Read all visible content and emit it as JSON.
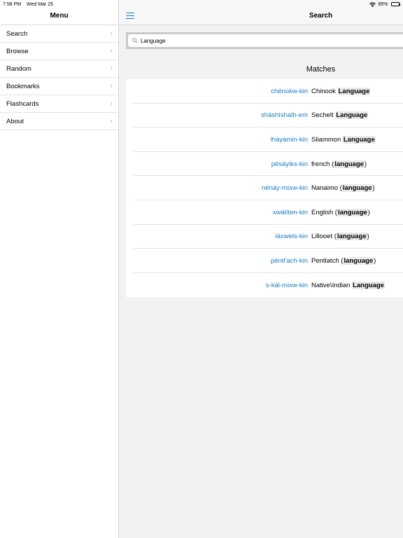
{
  "status_bar": {
    "time": "7:58 PM",
    "date": "Wed Mar 25",
    "battery": "85%",
    "battery_level": 0.85
  },
  "sidebar": {
    "title": "Menu",
    "items": [
      {
        "label": "Search"
      },
      {
        "label": "Browse"
      },
      {
        "label": "Random"
      },
      {
        "label": "Bookmarks"
      },
      {
        "label": "Flashcards"
      },
      {
        "label": "About"
      }
    ]
  },
  "nav": {
    "title": "Search"
  },
  "search": {
    "value": "Language",
    "placeholder": ""
  },
  "matches": {
    "title": "Matches",
    "results": [
      {
        "native": "chénúkw-kin",
        "english_pre": "Chinook ",
        "english_hl": "Language",
        "english_post": ""
      },
      {
        "native": "sháshíshalh-em",
        "english_pre": "Sechelt ",
        "english_hl": "Language",
        "english_post": ""
      },
      {
        "native": "lhàyámin-kin",
        "english_pre": "Sliammon ",
        "english_hl": "Language",
        "english_post": ""
      },
      {
        "native": "pésáyiks-kin",
        "english_pre": "french (",
        "english_hl": "language",
        "english_post": ")"
      },
      {
        "native": "nénáy-mixw-kin",
        "english_pre": "Nanaimo (",
        "english_hl": "language",
        "english_post": ")"
      },
      {
        "native": "xwálíten-kin",
        "english_pre": "English (",
        "english_hl": "language",
        "english_post": ")"
      },
      {
        "native": "láxwels-kin",
        "english_pre": "Lillooet (",
        "english_hl": "language",
        "english_post": ")"
      },
      {
        "native": "péntl'ach-kin",
        "english_pre": "Pentlatch (",
        "english_hl": "language",
        "english_post": ")"
      },
      {
        "native": "s-kál-mixw-kin",
        "english_pre": "Native\\Indian ",
        "english_hl": "Language",
        "english_post": ""
      }
    ]
  },
  "colors": {
    "accent": "#1a7ac4",
    "background": "#f2f2f2"
  }
}
